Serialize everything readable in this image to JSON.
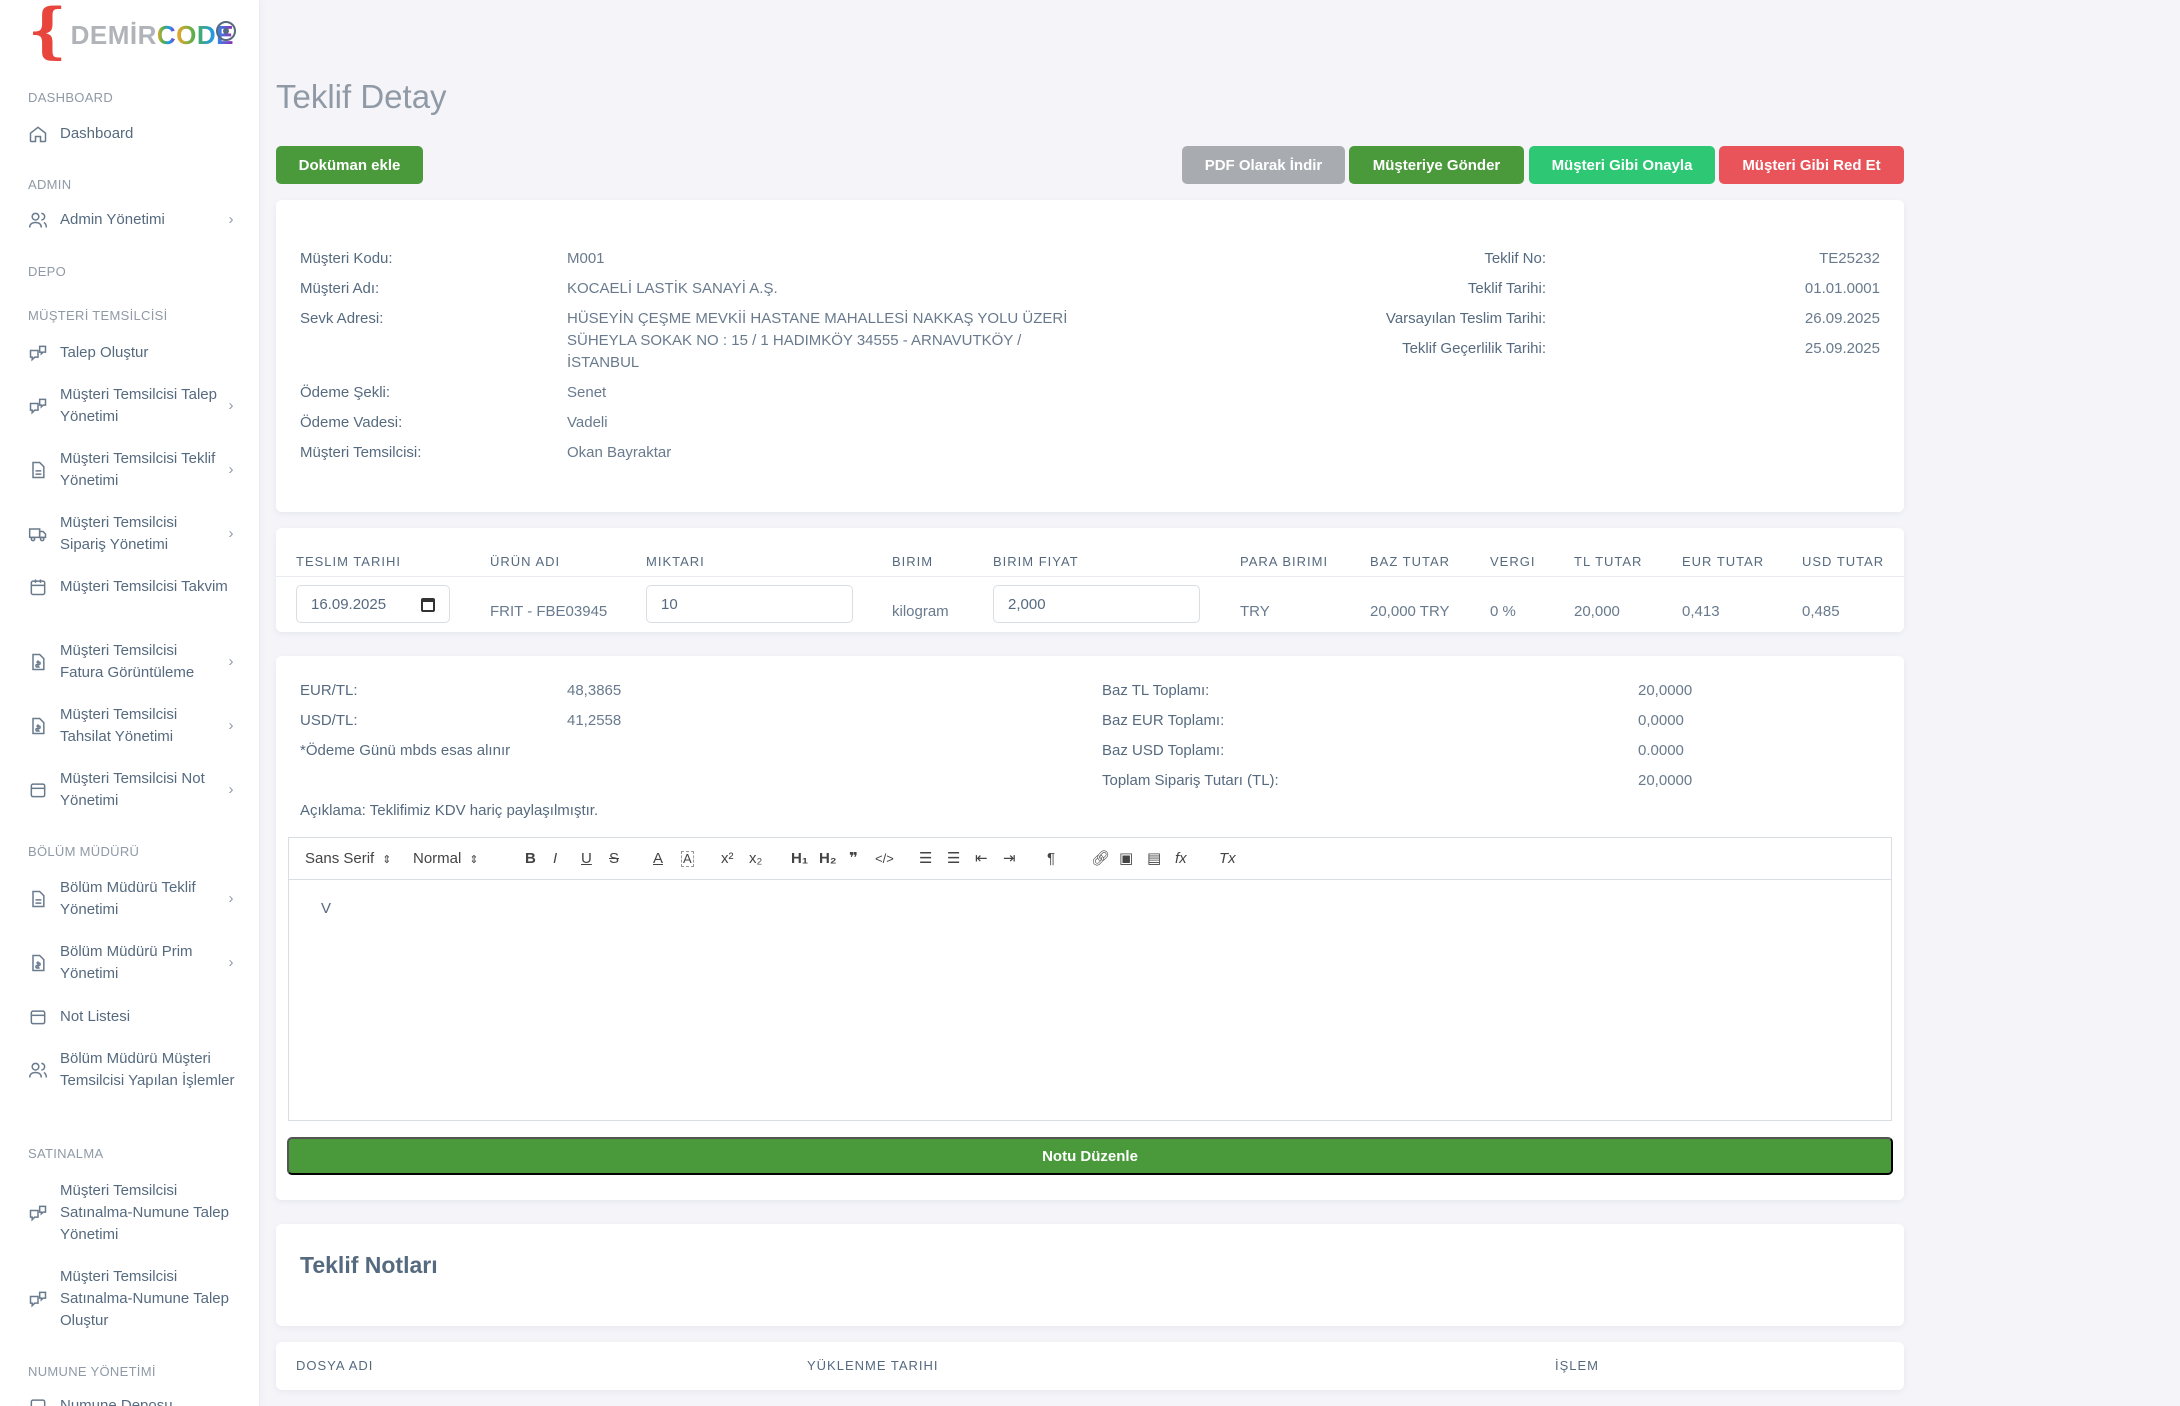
{
  "brand": {
    "brace": "{",
    "part1": "DEMİR",
    "part2": "C",
    "part3": "ODE"
  },
  "sidebar": {
    "sections": [
      {
        "header": "DASHBOARD",
        "items": [
          {
            "label": "Dashboard",
            "icon": "home-icon"
          }
        ]
      },
      {
        "header": "ADMIN",
        "items": [
          {
            "label": "Admin Yönetimi",
            "icon": "users-icon",
            "chevron": "›"
          }
        ]
      },
      {
        "header": "DEPO",
        "items": []
      },
      {
        "header": "MÜŞTERİ TEMSİLCİSİ",
        "items": [
          {
            "label": "Talep Oluştur",
            "icon": "messages-icon"
          },
          {
            "label": "Müşteri Temsilcisi Talep Yönetimi",
            "icon": "messages-icon",
            "chevron": "›"
          },
          {
            "label": "Müşteri Temsilcisi Teklif Yönetimi",
            "icon": "file-icon",
            "chevron": "›"
          },
          {
            "label": "Müşteri Temsilcisi Sipariş Yönetimi",
            "icon": "truck-icon",
            "chevron": "›"
          },
          {
            "label": "Müşteri Temsilcisi Takvim",
            "icon": "calendar-icon"
          },
          {
            "label": "Müşteri Temsilcisi Fatura Görüntüleme",
            "icon": "invoice-icon",
            "chevron": "›"
          },
          {
            "label": "Müşteri Temsilcisi Tahsilat Yönetimi",
            "icon": "invoice-icon",
            "chevron": "›"
          },
          {
            "label": "Müşteri Temsilcisi Not Yönetimi",
            "icon": "note-icon",
            "chevron": "›"
          }
        ]
      },
      {
        "header": "BÖLÜM MÜDÜRÜ",
        "items": [
          {
            "label": "Bölüm Müdürü Teklif Yönetimi",
            "icon": "file-icon",
            "chevron": "›"
          },
          {
            "label": "Bölüm Müdürü Prim Yönetimi",
            "icon": "invoice-icon",
            "chevron": "›"
          },
          {
            "label": "Not Listesi",
            "icon": "note-icon"
          },
          {
            "label": "Bölüm Müdürü Müşteri Temsilcisi Yapılan İşlemler",
            "icon": "users-icon"
          }
        ]
      },
      {
        "header": "SATINALMA",
        "items": [
          {
            "label": "Müşteri Temsilcisi Satınalma-Numune Talep Yönetimi",
            "icon": "messages-icon"
          },
          {
            "label": "Müşteri Temsilcisi Satınalma-Numune Talep Oluştur",
            "icon": "messages-icon"
          }
        ]
      },
      {
        "header": "NUMUNE YÖNETİMİ",
        "items": [
          {
            "label": "Numune Deposu",
            "icon": "box-icon"
          }
        ]
      }
    ]
  },
  "page": {
    "title": "Teklif Detay"
  },
  "actions": {
    "add_document": "Doküman ekle",
    "pdf": "PDF Olarak İndir",
    "send": "Müşteriye Gönder",
    "approve": "Müşteri Gibi Onayla",
    "reject": "Müşteri Gibi Red Et"
  },
  "customer_info": {
    "code_label": "Müşteri Kodu:",
    "code": "M001",
    "name_label": "Müşteri Adı:",
    "name": "KOCAELİ LASTİK SANAYİ A.Ş.",
    "address_label": "Sevk Adresi:",
    "address_lines": [
      "HÜSEYİN ÇEŞME MEVKİİ HASTANE MAHALLESİ NAKKAŞ YOLU ÜZERİ",
      "SÜHEYLA SOKAK NO : 15 / 1  HADIMKÖY 34555 - ARNAVUTKÖY /",
      "İSTANBUL"
    ],
    "payment_type_label": "Ödeme Şekli:",
    "payment_type": "Senet",
    "payment_term_label": "Ödeme Vadesi:",
    "payment_term": "Vadeli",
    "rep_label": "Müşteri Temsilcisi:",
    "rep": "Okan Bayraktar"
  },
  "offer_info": {
    "no_label": "Teklif No:",
    "no": "TE25232",
    "date_label": "Teklif Tarihi:",
    "date": "01.01.0001",
    "delivery_label": "Varsayılan Teslim Tarihi:",
    "delivery": "26.09.2025",
    "validity_label": "Teklif Geçerlilik Tarihi:",
    "validity": "25.09.2025"
  },
  "items_table": {
    "headers": [
      "TESLIM TARIHI",
      "ÜRÜN ADI",
      "MIKTARI",
      "BIRIM",
      "BIRIM FIYAT",
      "PARA BIRIMI",
      "BAZ TUTAR",
      "VERGI",
      "TL TUTAR",
      "EUR TUTAR",
      "USD TUTAR"
    ],
    "row": {
      "delivery_date": "16.09.2025",
      "product": "FRIT - FBE03945",
      "quantity": "10",
      "unit": "kilogram",
      "unit_price": "2,000",
      "currency": "TRY",
      "base_amount": "20,000 TRY",
      "tax": "0 %",
      "tl_amount": "20,000",
      "eur_amount": "0,413",
      "usd_amount": "0,485"
    }
  },
  "totals": {
    "eur_tl_label": "EUR/TL:",
    "eur_tl": "48,3865",
    "usd_tl_label": "USD/TL:",
    "usd_tl": "41,2558",
    "payment_note": "*Ödeme Günü mbds esas alınır",
    "base_tl_label": "Baz TL Toplamı:",
    "base_tl": "20,0000",
    "base_eur_label": "Baz EUR Toplamı:",
    "base_eur": "0,0000",
    "base_usd_label": "Baz USD Toplamı:",
    "base_usd": "0.0000",
    "total_label": "Toplam Sipariş Tutarı (TL):",
    "total": "20,0000",
    "description": "Açıklama: Teklifimiz KDV hariç paylaşılmıştır."
  },
  "editor": {
    "font": "Sans Serif",
    "size": "Normal",
    "content": "V",
    "save_button": "Notu Düzenle"
  },
  "notes": {
    "title": "Teklif Notları"
  },
  "files_table": {
    "headers": [
      "DOSYA ADI",
      "YÜKLENME TARIHI",
      "İŞLEM"
    ]
  }
}
